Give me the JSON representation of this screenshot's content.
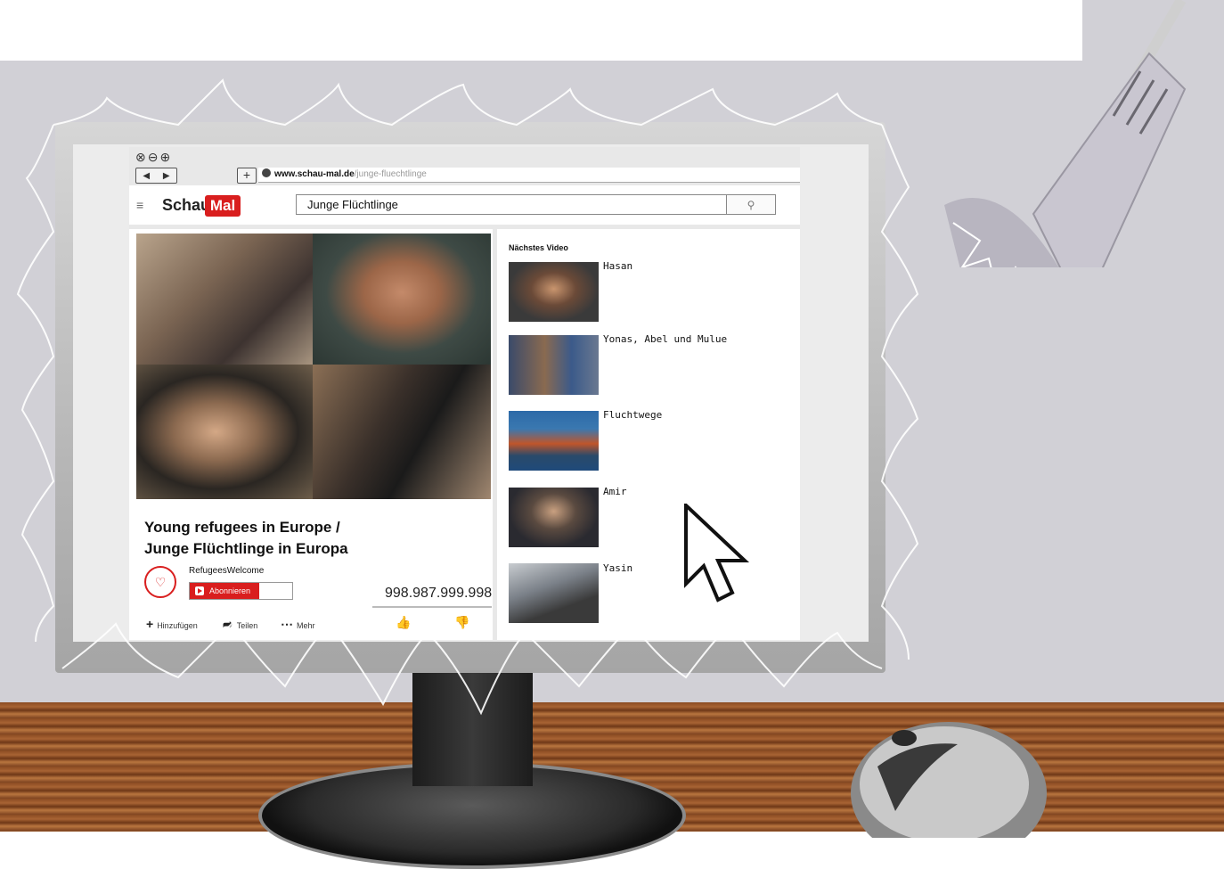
{
  "browser": {
    "window_controls": "⊗⊖⊕",
    "nav_back": "◀",
    "nav_forward": "▶",
    "new_tab": "+",
    "url_domain": "www.schau-mal.de",
    "url_path": "/junge-fluechtlinge"
  },
  "site": {
    "menu_icon": "≡",
    "logo_schau": "Schau",
    "logo_mal": "Mal",
    "search_value": "Junge Flüchtlinge",
    "search_icon": "⚲"
  },
  "video": {
    "title_line1": "Young refugees in Europe /",
    "title_line2": "Junge Flüchtlinge in Europa",
    "channel_name": "RefugeesWelcome",
    "subscribe_label": "Abonnieren",
    "view_count": "998.987.999.998",
    "actions": {
      "add_label": "Hinzufügen",
      "share_label": "Teilen",
      "more_label": "Mehr"
    }
  },
  "sidebar": {
    "heading": "Nächstes Video",
    "items": [
      {
        "label": "Hasan"
      },
      {
        "label": "Yonas, Abel und Mulue"
      },
      {
        "label": "Fluchtwege"
      },
      {
        "label": "Amir"
      },
      {
        "label": "Yasin"
      }
    ]
  },
  "colors": {
    "brand_red": "#d91e1e",
    "wall": "#d1d0d6",
    "desk": "#8a4b22"
  }
}
